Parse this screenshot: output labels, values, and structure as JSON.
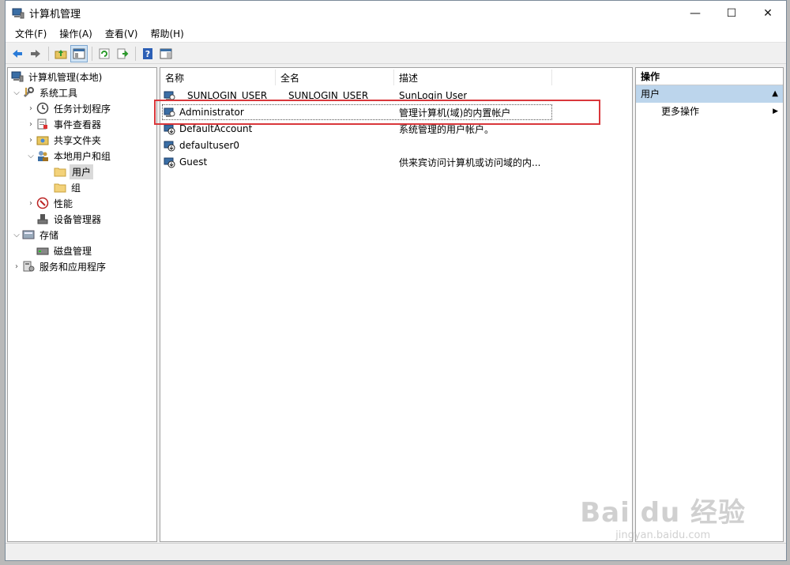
{
  "window": {
    "title": "计算机管理"
  },
  "controls": {
    "minimize": "—",
    "maximize": "☐",
    "close": "✕"
  },
  "menu": [
    "文件(F)",
    "操作(A)",
    "查看(V)",
    "帮助(H)"
  ],
  "tree": {
    "root": "计算机管理(本地)",
    "system_tools": "系统工具",
    "task_scheduler": "任务计划程序",
    "event_viewer": "事件查看器",
    "shared_folders": "共享文件夹",
    "local_users": "本地用户和组",
    "users": "用户",
    "groups": "组",
    "performance": "性能",
    "device_manager": "设备管理器",
    "storage": "存储",
    "disk_management": "磁盘管理",
    "services": "服务和应用程序"
  },
  "columns": {
    "name": "名称",
    "fullname": "全名",
    "description": "描述"
  },
  "rows": [
    {
      "name": "SUNLOGIN_USER",
      "fullname": "SUNLOGIN_USER",
      "description": "SunLogin User"
    },
    {
      "name": "Administrator",
      "fullname": "",
      "description": "管理计算机(域)的内置帐户"
    },
    {
      "name": "DefaultAccount",
      "fullname": "",
      "description": "系统管理的用户帐户。"
    },
    {
      "name": "defaultuser0",
      "fullname": "",
      "description": ""
    },
    {
      "name": "Guest",
      "fullname": "",
      "description": "供来宾访问计算机或访问域的内..."
    }
  ],
  "actions": {
    "header": "操作",
    "section": "用户",
    "more": "更多操作"
  },
  "watermark": {
    "main": "Bai du 经验",
    "sub": "jingyan.baidu.com"
  },
  "colors": {
    "highlight_box": "#d9373b",
    "section_bg": "#bcd5ec",
    "selected_bg": "#d9d9d9"
  }
}
